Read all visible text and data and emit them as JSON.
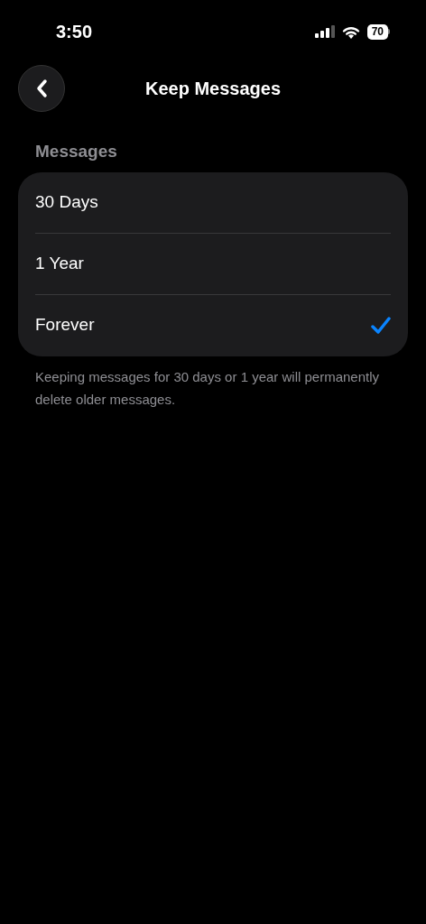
{
  "status_bar": {
    "time": "3:50",
    "battery": "70"
  },
  "header": {
    "title": "Keep Messages"
  },
  "section": {
    "title": "Messages",
    "options": [
      {
        "label": "30 Days",
        "selected": false
      },
      {
        "label": "1 Year",
        "selected": false
      },
      {
        "label": "Forever",
        "selected": true
      }
    ],
    "footer": "Keeping messages for 30 days or 1 year will permanently delete older messages."
  }
}
